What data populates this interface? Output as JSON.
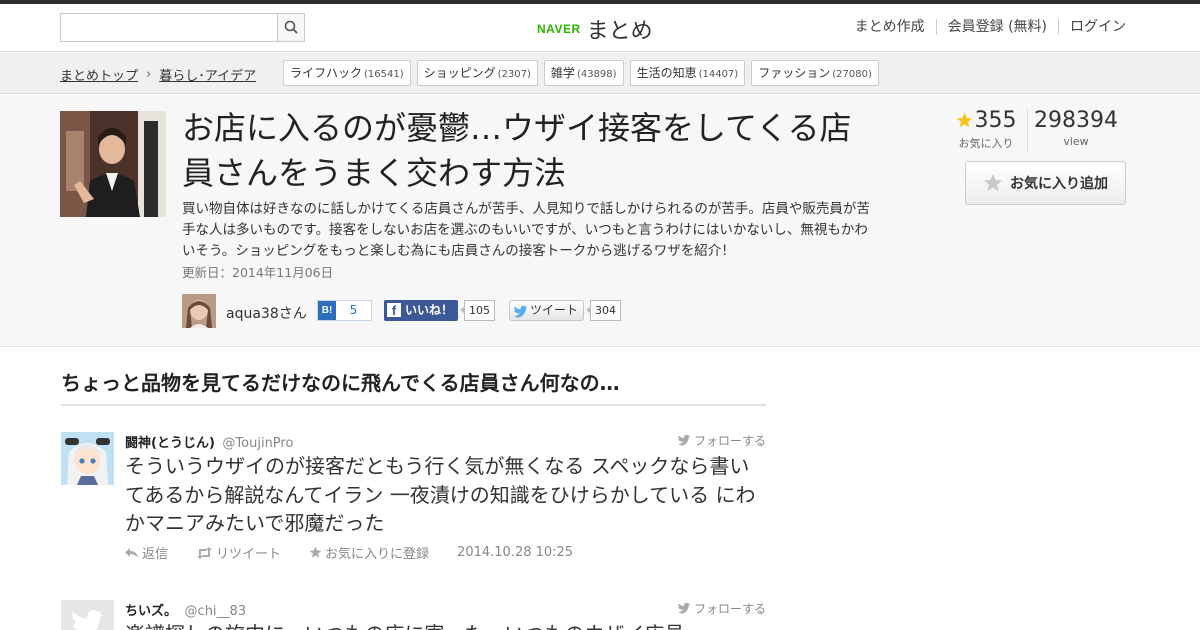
{
  "header": {
    "search": {
      "placeholder": "",
      "value": ""
    },
    "logo": {
      "brand": "NAVER",
      "service": "まとめ"
    },
    "nav": [
      "まとめ作成",
      "会員登録 (無料)",
      "ログイン"
    ]
  },
  "breadcrumb": {
    "items": [
      "まとめトップ",
      "暮らし･アイデア"
    ],
    "separator": "›"
  },
  "tags": [
    {
      "label": "ライフハック",
      "count": "(16541)"
    },
    {
      "label": "ショッピング",
      "count": "(2307)"
    },
    {
      "label": "雑学",
      "count": "(43898)"
    },
    {
      "label": "生活の知恵",
      "count": "(14407)"
    },
    {
      "label": "ファッション",
      "count": "(27080)"
    }
  ],
  "article": {
    "title": "お店に入るのが憂鬱…ウザイ接客をしてくる店員さんをうまく交わす方法",
    "description": "買い物自体は好きなのに話しかけてくる店員さんが苦手、人見知りで話しかけられるのが苦手。店員や販売員が苦手な人は多いものです。接客をしないお店を選ぶのもいいですが、いつもと言うわけにはいかないし、無視もかわいそう。ショッピングをもっと楽しむ為にも店員さんの接客トークから逃げるワザを紹介！",
    "updated": "更新日：2014年11月06日",
    "author": "aqua38さん",
    "social": {
      "hatena_icon": "B!",
      "hatena_count": "5",
      "facebook_label": "いいね！",
      "facebook_count": "105",
      "twitter_label": "ツイート",
      "twitter_count": "304"
    },
    "stats": {
      "favorites": "355",
      "favorites_label": "お気に入り",
      "views": "298394",
      "views_label": "view"
    },
    "fav_button": "お気に入り追加"
  },
  "section": {
    "title": "ちょっと品物を見てるだけなのに飛んでくる店員さん何なの…"
  },
  "tweets": [
    {
      "name": "闘神(とうじん)",
      "handle": "@ToujinPro",
      "follow": "フォローする",
      "text": "そういうウザイのが接客だともう行く気が無くなる スペックなら書いてあるから解説なんてイラン 一夜漬けの知識をひけらかしている にわかマニアみたいで邪魔だった",
      "reply": "返信",
      "retweet": "リツイート",
      "favorite": "お気に入りに登録",
      "date": "2014.10.28 10:25"
    },
    {
      "name": "ちいズ。",
      "handle": "@chi__83",
      "follow": "フォローする",
      "text": "楽譜探しの旅中に、いつもの店に寄った。いつものウザイ店員"
    }
  ],
  "colors": {
    "naver_green": "#2db400",
    "hatena_blue": "#2c6ebd",
    "facebook_blue": "#3b5998",
    "star_yellow": "#f5c518"
  }
}
